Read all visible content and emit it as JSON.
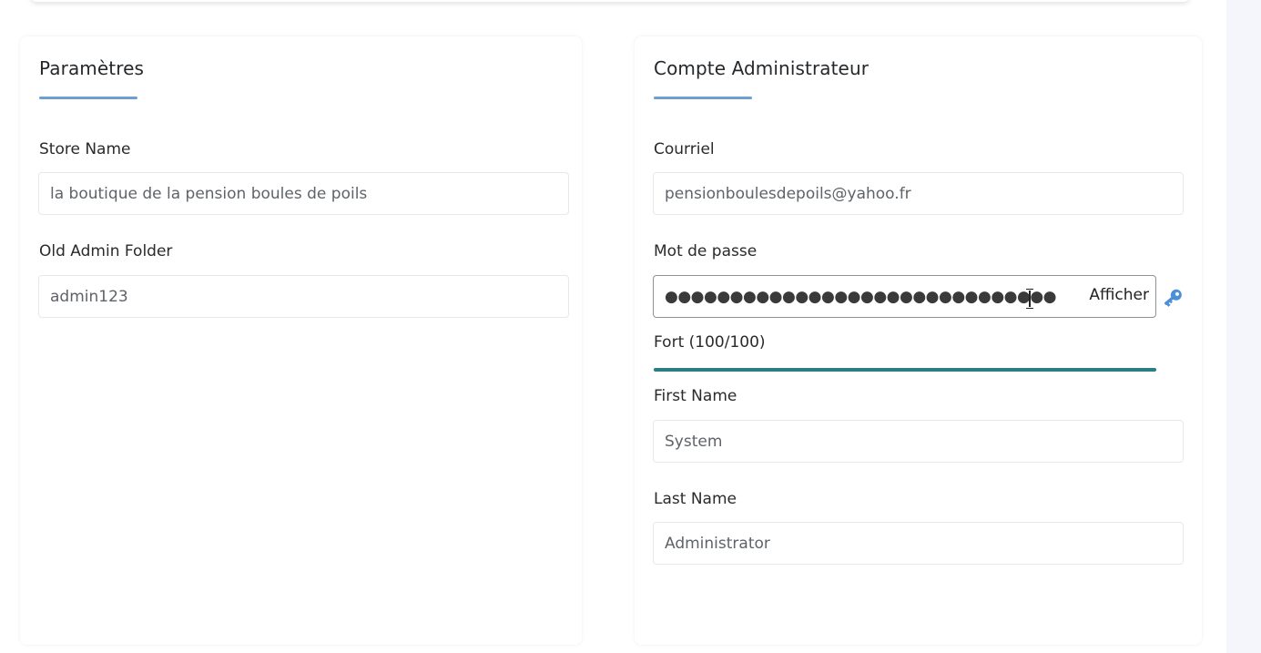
{
  "settings": {
    "title": "Paramètres",
    "store_name_label": "Store Name",
    "store_name_value": "la boutique de la pension boules de poils",
    "old_admin_folder_label": "Old Admin Folder",
    "old_admin_folder_value": "admin123"
  },
  "admin_account": {
    "title": "Compte Administrateur",
    "email_label": "Courriel",
    "email_value": "pensionboulesdepoils@yahoo.fr",
    "password_label": "Mot de passe",
    "password_masked": "●●●●●●●●●●●●●●●●●●●●●●●●●●●●●●",
    "show_password_label": "Afficher",
    "strength_text": "Fort (100/100)",
    "strength_score": 100,
    "first_name_label": "First Name",
    "first_name_value": "System",
    "last_name_label": "Last Name",
    "last_name_value": "Administrator"
  },
  "colors": {
    "title_underline": "#6f9ed2",
    "strength_bar": "#2b7e84",
    "key_icon": "#4a90d9"
  },
  "icons": {
    "key": "key-icon",
    "cursor": "text-cursor-icon"
  }
}
